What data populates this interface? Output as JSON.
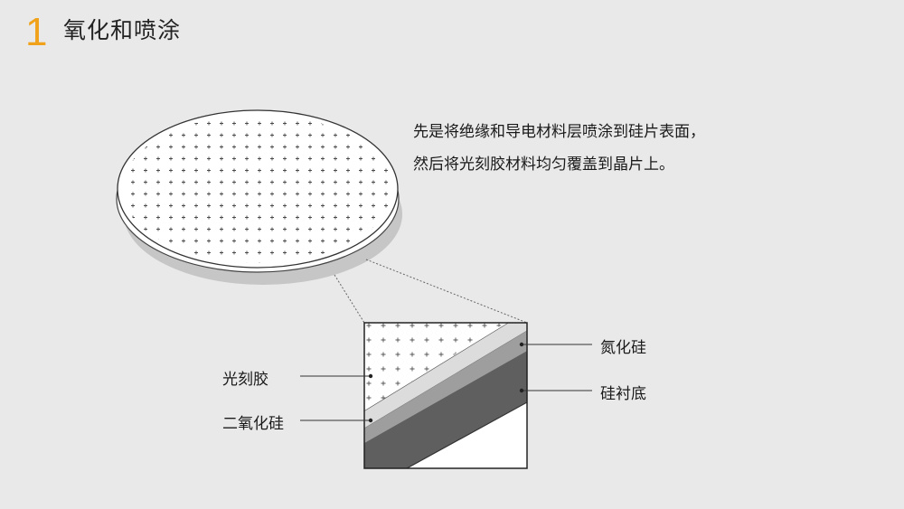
{
  "header": {
    "number": "1",
    "title": "氧化和喷涂"
  },
  "description": {
    "line1": "先是将绝缘和导电材料层喷涂到硅片表面，",
    "line2": "然后将光刻胶材料均匀覆盖到晶片上。"
  },
  "labels": {
    "photoresist": "光刻胶",
    "silicon_dioxide": "二氧化硅",
    "silicon_nitride": "氮化硅",
    "silicon_substrate": "硅衬底"
  },
  "colors": {
    "accent": "#f0a21a",
    "background": "#e8e9e8"
  }
}
